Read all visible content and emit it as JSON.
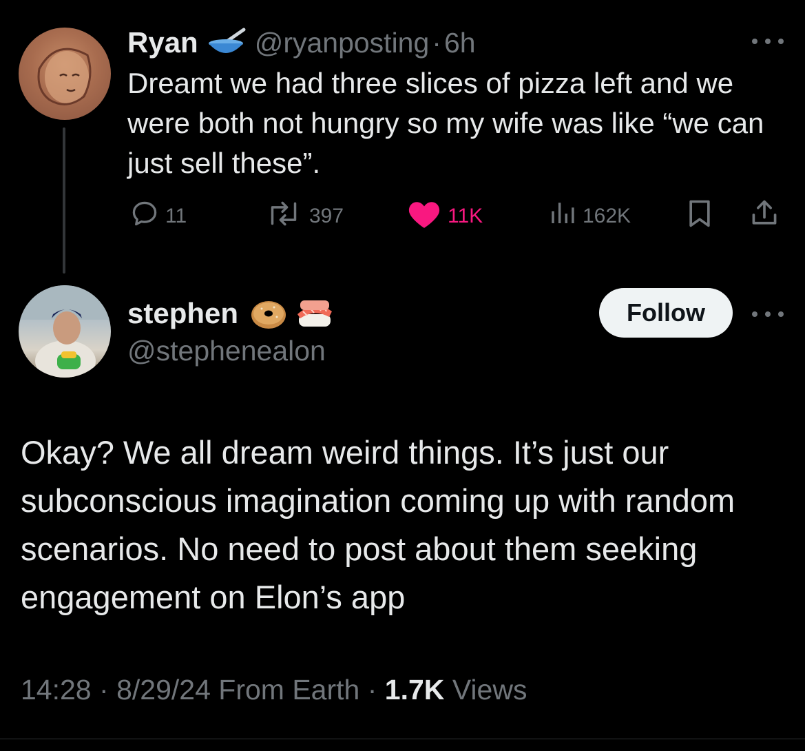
{
  "original_tweet": {
    "author_name": "Ryan",
    "author_badge_icon": "bowl-with-spoon-emoji",
    "handle": "@ryanposting",
    "separator": "·",
    "time": "6h",
    "text": "Dreamt we had three slices of pizza left and we were both not hungry so my wife was like “we can just sell these”.",
    "stats": {
      "replies": "11",
      "retweets": "397",
      "likes": "11K",
      "views": "162K"
    }
  },
  "reply_tweet": {
    "author_name": "stephen",
    "author_badge_icons": [
      "bagel-emoji",
      "sushi-emoji"
    ],
    "handle": "@stephenealon",
    "follow_label": "Follow",
    "text": "Okay? We all dream weird things. It’s just our subconscious imagination coming up with random scenarios. No need to post about them seeking engagement on Elon’s app",
    "time": "14:28",
    "date": "8/29/24",
    "source": "From Earth",
    "separator": "·",
    "views_count": "1.7K",
    "views_label": "Views"
  },
  "colors": {
    "background": "#000000",
    "text": "#e7e9ea",
    "muted": "#71767b",
    "like_active": "#f91880",
    "follow_bg": "#eff3f4"
  }
}
